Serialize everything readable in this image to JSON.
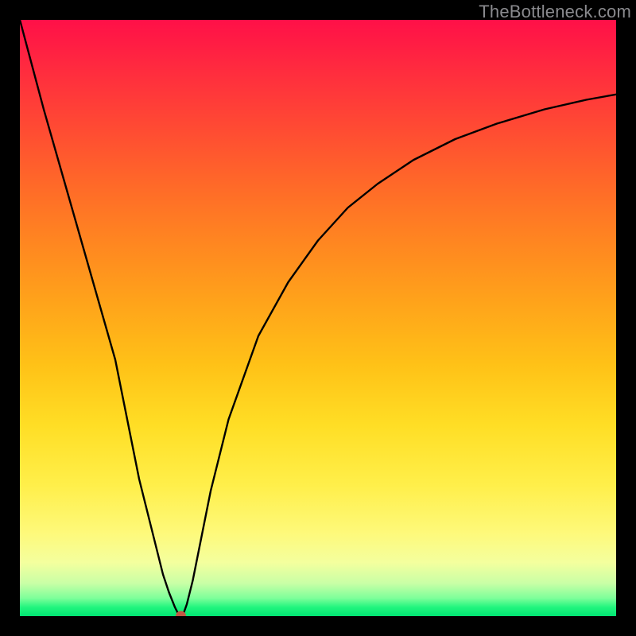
{
  "watermark": "TheBottleneck.com",
  "chart_data": {
    "type": "line",
    "title": "",
    "xlabel": "",
    "ylabel": "",
    "xlim": [
      0,
      100
    ],
    "ylim": [
      0,
      100
    ],
    "grid": false,
    "legend": false,
    "marker": {
      "x": 27,
      "y": 0,
      "color": "#c35644"
    },
    "series": [
      {
        "name": "curve",
        "color": "#000000",
        "x": [
          0,
          4,
          8,
          12,
          16,
          20,
          22,
          24,
          25,
          26,
          26.5,
          27,
          27.5,
          28,
          29,
          30,
          32,
          35,
          40,
          45,
          50,
          55,
          60,
          66,
          73,
          80,
          88,
          95,
          100
        ],
        "y": [
          100,
          85,
          71,
          57,
          43,
          23,
          15,
          7,
          4,
          1.5,
          0.5,
          0,
          0.6,
          2,
          6,
          11,
          21,
          33,
          47,
          56,
          63,
          68.5,
          72.5,
          76.5,
          80,
          82.6,
          85,
          86.6,
          87.5
        ]
      }
    ]
  }
}
